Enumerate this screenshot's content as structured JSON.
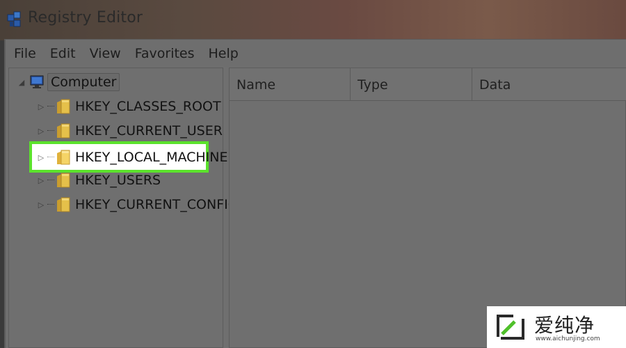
{
  "window": {
    "title": "Registry Editor"
  },
  "menubar": {
    "items": [
      "File",
      "Edit",
      "View",
      "Favorites",
      "Help"
    ]
  },
  "tree": {
    "root": "Computer",
    "items": [
      {
        "label": "HKEY_CLASSES_ROOT",
        "highlighted": false
      },
      {
        "label": "HKEY_CURRENT_USER",
        "highlighted": false
      },
      {
        "label": "HKEY_LOCAL_MACHINE",
        "highlighted": true
      },
      {
        "label": "HKEY_USERS",
        "highlighted": false
      },
      {
        "label": "HKEY_CURRENT_CONFIG",
        "highlighted": false
      }
    ]
  },
  "details": {
    "columns": [
      "Name",
      "Type",
      "Data"
    ]
  },
  "watermark": {
    "text": "爱纯净",
    "subtext": "www.aichunjing.com"
  },
  "colors": {
    "highlight_border": "#5be22c",
    "folder": "#e5c04a"
  }
}
